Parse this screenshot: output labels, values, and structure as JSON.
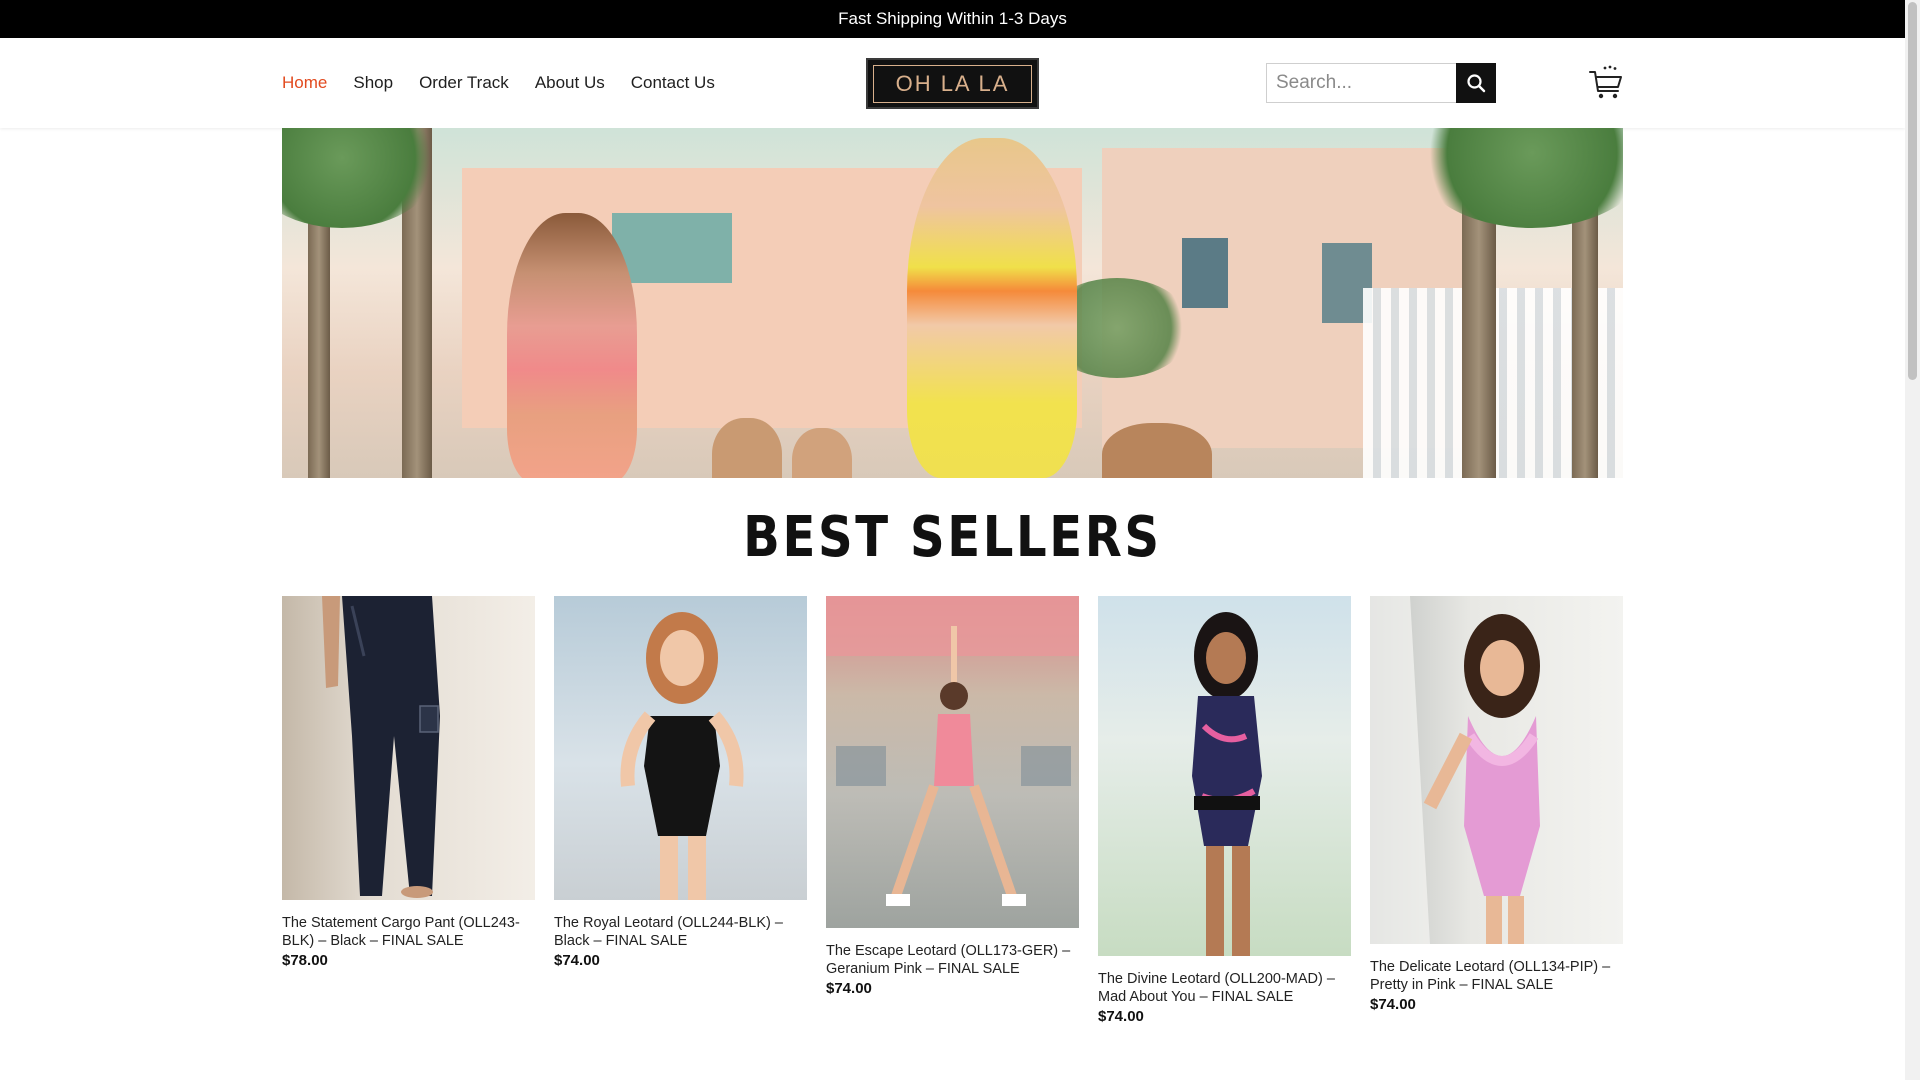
{
  "topbar": {
    "text": "Fast Shipping Within 1-3 Days"
  },
  "nav": {
    "items": [
      {
        "label": "Home",
        "active": true
      },
      {
        "label": "Shop"
      },
      {
        "label": "Order Track"
      },
      {
        "label": "About Us"
      },
      {
        "label": "Contact Us"
      }
    ]
  },
  "logo": {
    "text": "OH LA LA"
  },
  "search": {
    "placeholder": "Search..."
  },
  "icons": {
    "search": "search-icon",
    "cart": "cart-icon"
  },
  "section": {
    "title": "BEST SELLERS"
  },
  "products": [
    {
      "name": "The Statement Cargo Pant (OLL243-BLK) – Black – FINAL SALE",
      "price": "$78.00"
    },
    {
      "name": "The Royal Leotard (OLL244-BLK) – Black – FINAL SALE",
      "price": "$74.00"
    },
    {
      "name": "The Escape Leotard (OLL173-GER) – Geranium Pink – FINAL SALE",
      "price": "$74.00"
    },
    {
      "name": "The Divine Leotard (OLL200-MAD) – Mad About You – FINAL SALE",
      "price": "$74.00"
    },
    {
      "name": "The Delicate Leotard (OLL134-PIP) – Pretty in Pink – FINAL SALE",
      "price": "$74.00"
    }
  ],
  "colors": {
    "accent": "#e24a1f",
    "topbar": "#000000",
    "logo_border": "#d9b08c"
  }
}
